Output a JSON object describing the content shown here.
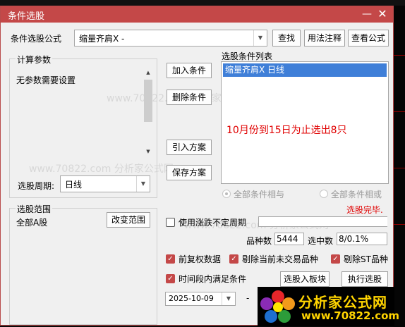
{
  "window": {
    "title": "条件选股"
  },
  "formula": {
    "label": "条件选股公式",
    "selected": "缩量齐肩X  -",
    "buttons": {
      "find": "查找",
      "usage": "用法注释",
      "view": "查看公式"
    }
  },
  "params": {
    "group_title": "计算参数",
    "text": "无参数需要设置",
    "period_label": "选股周期:",
    "period_value": "日线"
  },
  "actions": {
    "add": "加入条件",
    "delete": "删除条件",
    "import": "引入方案",
    "save": "保存方案"
  },
  "conditions": {
    "title": "选股条件列表",
    "items": [
      "缩量齐肩X  日线"
    ],
    "note": "10月份到15日为止选出8只"
  },
  "logic": {
    "and": "全部条件相与",
    "or": "全部条件相或",
    "status": "选股完毕."
  },
  "range": {
    "group_title": "选股范围",
    "value": "全部A股",
    "change": "改变范围"
  },
  "options": {
    "uncertain_period": "使用涨跌不定周期",
    "count_label": "品种数",
    "count_value": "5444",
    "selected_label": "选中数",
    "selected_value": "8/0.1%",
    "forward_adjust": "前复权数据",
    "exclude_no_trade": "剔除当前未交易品种",
    "exclude_st": "剔除ST品种",
    "time_range": "时间段内满足条件",
    "to_block": "选股入板块",
    "execute": "执行选股",
    "date": "2025-10-09",
    "dash": "-"
  },
  "watermark": {
    "text": "www.70822.com 分析家公式网"
  },
  "logo": {
    "line1": "分析家公式网",
    "line2": "www.70822.com"
  },
  "colors": {
    "title_bar": "#c44848",
    "accent": "#c44848",
    "note_red": "#e00000",
    "list_selected": "#3f7fd8",
    "logo_text": "#ffd400"
  }
}
